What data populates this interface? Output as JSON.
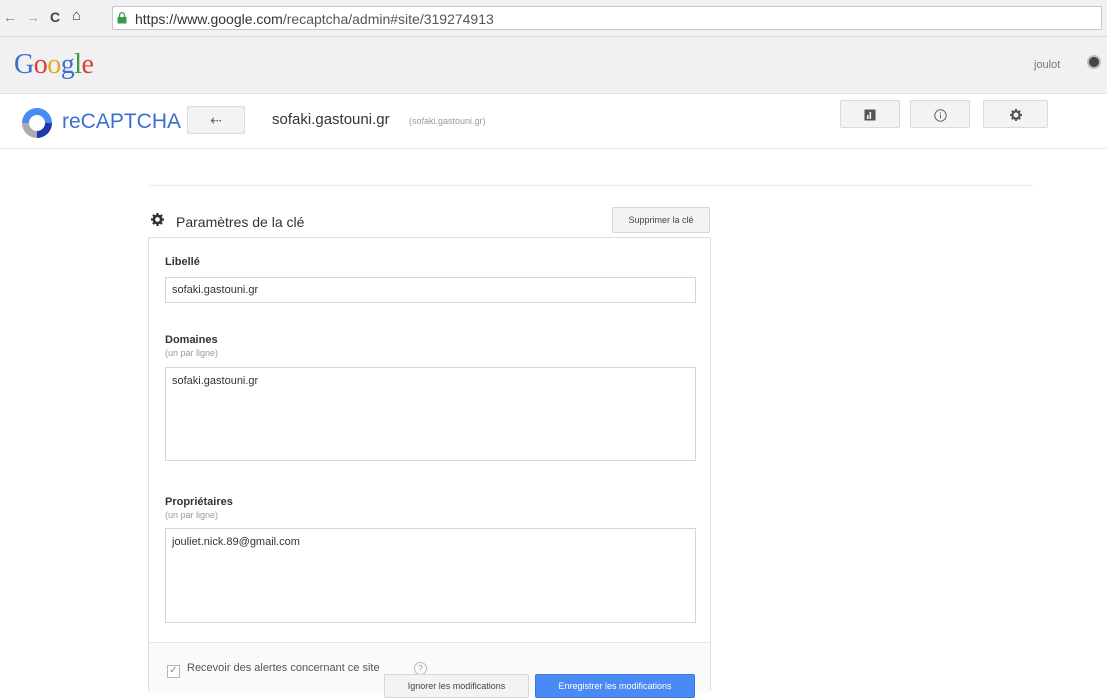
{
  "browser": {
    "url_scheme_host": "https://www.google.com",
    "url_path": "/recaptcha/admin#site/319274913",
    "nav_back": "←",
    "nav_forward": "→",
    "nav_reload": "C",
    "nav_home": "⌂"
  },
  "google_header": {
    "logo": [
      "G",
      "o",
      "o",
      "g",
      "l",
      "e"
    ],
    "user_name": "joulot"
  },
  "recaptcha_bar": {
    "title": "reCAPTCHA",
    "back_glyph": "⇠",
    "site_name": "sofaki.gastouni.gr",
    "site_domain": "(sofaki.gastouni.gr)",
    "tool_icons": [
      "chart-icon",
      "info-icon",
      "gear-icon"
    ]
  },
  "key_settings": {
    "title": "Paramètres de la clé",
    "delete_button": "Supprimer la clé",
    "label_field": {
      "label": "Libellé",
      "value": "sofaki.gastouni.gr"
    },
    "domains_field": {
      "label": "Domaines",
      "hint": "(un par ligne)",
      "value": "sofaki.gastouni.gr"
    },
    "owners_field": {
      "label": "Propriétaires",
      "hint": "(un par ligne)",
      "value": "jouliet.nick.89@gmail.com"
    },
    "alerts_checkbox": {
      "label": "Recevoir des alertes concernant ce site",
      "checked": true
    },
    "ignore_button": "Ignorer les modifications",
    "save_button": "Enregistrer les modifications"
  },
  "colors": {
    "accent": "#4a8af4",
    "recaptcha_blue": "#3b6fcf"
  }
}
